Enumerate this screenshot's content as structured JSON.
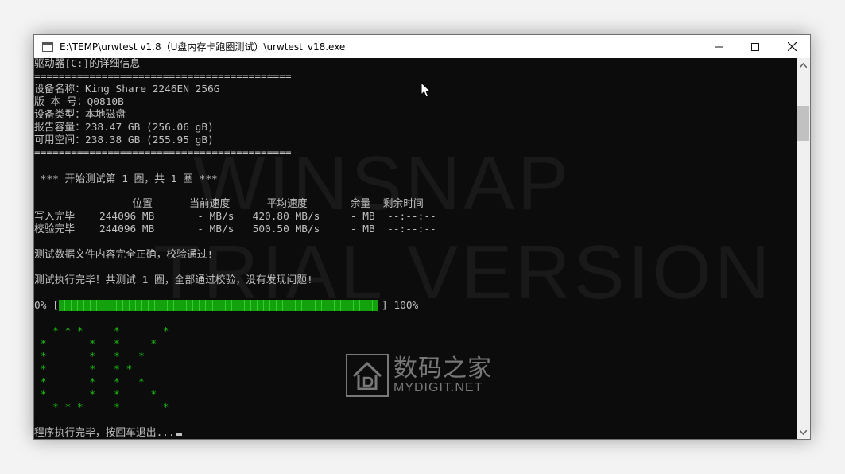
{
  "window": {
    "title": "E:\\TEMP\\urwtest v1.8（U盘内存卡跑圈测试）\\urwtest_v18.exe",
    "minimize_icon": "minimize-icon",
    "maximize_icon": "maximize-icon",
    "close_icon": "close-icon"
  },
  "console": {
    "drive_header": "驱动器[C:]的详细信息",
    "separator": "==========================================",
    "device_name": "设备名称：King Share 2246EN 256G",
    "version": "版 本 号：Q0810B",
    "device_type": "设备类型：本地磁盘",
    "reported_capacity": "报告容量：238.47 GB (256.06 gB)",
    "available_space": "可用空间：238.38 GB (255.95 gB)",
    "separator2": "==========================================",
    "test_start": " *** 开始测试第 1 圈，共 1 圈 ***",
    "table_header": "                位置      当前速度      平均速度       余量  剩余时间",
    "write_row": "写入完毕    244096 MB       - MB/s   420.80 MB/s     - MB  --:--:--",
    "verify_row": "校验完毕    244096 MB       - MB/s   500.50 MB/s     - MB  --:--:--",
    "data_ok_msg": "测试数据文件内容完全正确，校验通过!",
    "test_done_msg": "测试执行完毕！共测试 1 圈，全部通过校验，没有发现问题!",
    "progress_start": "0% [",
    "progress_end": "] 100%",
    "progress_percent": 100,
    "ok_art": [
      "   * * *     *       *",
      " *       *   *     *",
      " *       *   *   *",
      " *       *   * *",
      " *       *   *   *",
      " *       *   *     *",
      "   * * *     *       *"
    ],
    "exit_prompt": "程序执行完毕，按回车退出..."
  },
  "watermark": {
    "line1": "WINSNAP",
    "line2": "TRIAL VERSION"
  },
  "logo": {
    "cn": "数码之家",
    "en": "MYDIGIT.NET"
  },
  "colors": {
    "console_bg": "#0c0c0c",
    "console_text": "#c0c0c0",
    "progress_green": "#13a10e",
    "ok_green": "#16c60c"
  }
}
